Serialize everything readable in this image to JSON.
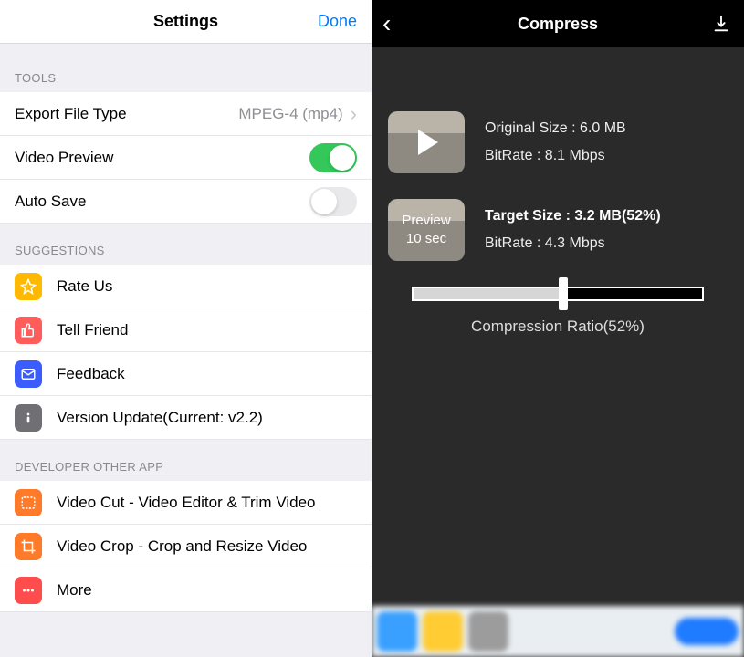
{
  "left": {
    "title": "Settings",
    "done": "Done",
    "sections": {
      "tools": {
        "header": "TOOLS",
        "export_label": "Export File Type",
        "export_value": "MPEG-4 (mp4)",
        "video_preview": "Video Preview",
        "auto_save": "Auto Save"
      },
      "suggestions": {
        "header": "SUGGESTIONS",
        "rate": "Rate Us",
        "tell": "Tell Friend",
        "feedback": "Feedback",
        "version": "Version Update(Current: v2.2)"
      },
      "dev": {
        "header": "DEVELOPER OTHER APP",
        "cut": "Video Cut - Video Editor & Trim Video",
        "crop": "Video Crop - Crop and Resize Video",
        "more": "More"
      }
    }
  },
  "right": {
    "title": "Compress",
    "original_size_label": "Original Size : 6.0 MB",
    "original_bitrate": "BitRate : 8.1 Mbps",
    "preview_text_l1": "Preview",
    "preview_text_l2": "10 sec",
    "target_size_label": "Target Size : 3.2 MB(52%)",
    "target_bitrate": "BitRate : 4.3 Mbps",
    "slider_label": "Compression Ratio(52%)",
    "slider_percent": 52
  }
}
